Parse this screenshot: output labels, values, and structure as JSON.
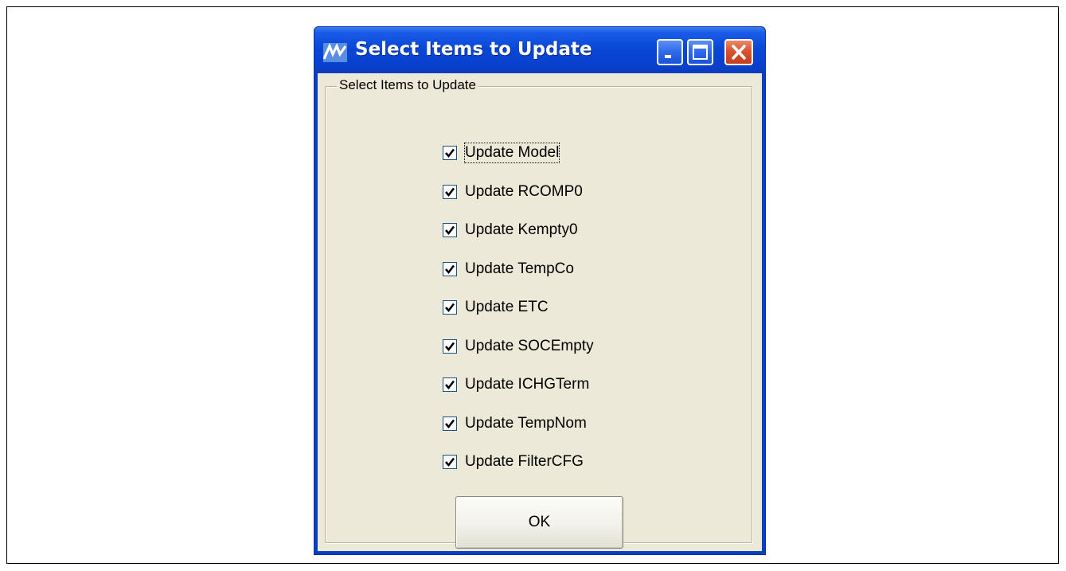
{
  "window": {
    "title": "Select Items to Update",
    "icon": "app-logo-icon",
    "controls": {
      "minimize_icon": "minimize-icon",
      "maximize_icon": "maximize-icon",
      "close_icon": "close-icon"
    }
  },
  "group": {
    "label": "Select Items to Update"
  },
  "checkboxes": [
    {
      "label": "Update Model",
      "checked": true
    },
    {
      "label": "Update RCOMP0",
      "checked": true
    },
    {
      "label": "Update Kempty0",
      "checked": true
    },
    {
      "label": "Update TempCo",
      "checked": true
    },
    {
      "label": "Update ETC",
      "checked": true
    },
    {
      "label": "Update SOCEmpty",
      "checked": true
    },
    {
      "label": "Update ICHGTerm",
      "checked": true
    },
    {
      "label": "Update TempNom",
      "checked": true
    },
    {
      "label": "Update FilterCFG",
      "checked": true
    }
  ],
  "buttons": {
    "ok_label": "OK"
  },
  "colors": {
    "titlebar": "#0a47d6",
    "client_background": "#ece9d8",
    "close_button": "#d9542e"
  }
}
